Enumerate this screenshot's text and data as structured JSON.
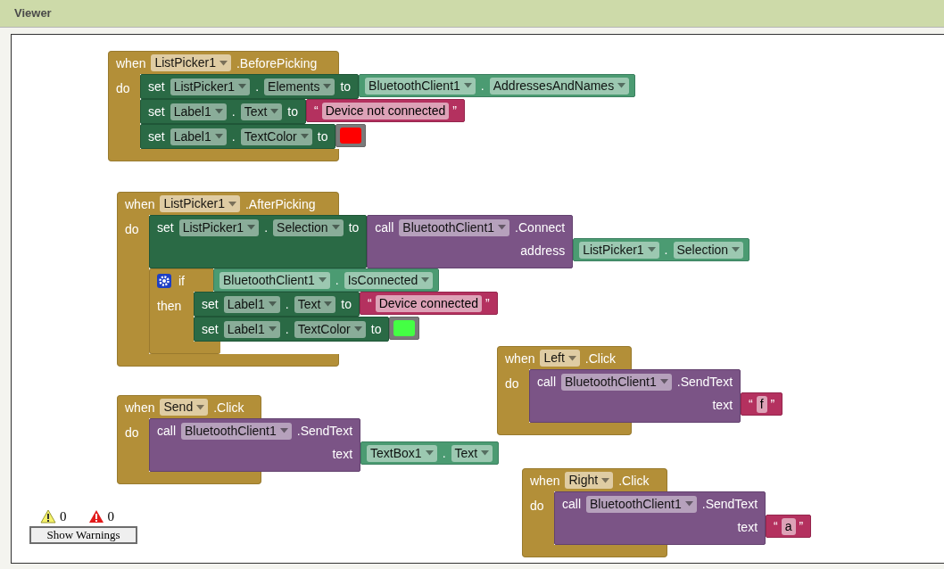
{
  "panel": {
    "title": "Viewer"
  },
  "blocks": [
    {
      "kind": "event",
      "when": "when",
      "component": "ListPicker1",
      "event": ".BeforePicking",
      "do": "do",
      "statements": [
        {
          "kind": "set",
          "keyword": "set",
          "component": "ListPicker1",
          "dot": ".",
          "property": "Elements",
          "to": "to",
          "value": {
            "kind": "getter",
            "component": "BluetoothClient1",
            "dot": ".",
            "property": "AddressesAndNames"
          }
        },
        {
          "kind": "set",
          "keyword": "set",
          "component": "Label1",
          "dot": ".",
          "property": "Text",
          "to": "to",
          "value": {
            "kind": "text",
            "open": "“",
            "text": "Device not connected",
            "close": "”"
          }
        },
        {
          "kind": "set",
          "keyword": "set",
          "component": "Label1",
          "dot": ".",
          "property": "TextColor",
          "to": "to",
          "value": {
            "kind": "color",
            "color": "#ff0000"
          }
        }
      ]
    },
    {
      "kind": "event",
      "when": "when",
      "component": "ListPicker1",
      "event": ".AfterPicking",
      "do": "do",
      "statements": [
        {
          "kind": "set",
          "keyword": "set",
          "component": "ListPicker1",
          "dot": ".",
          "property": "Selection",
          "to": "to",
          "value": {
            "kind": "call",
            "keyword": "call",
            "component": "BluetoothClient1",
            "method": ".Connect",
            "arg_label": "address",
            "arg": {
              "kind": "getter",
              "component": "ListPicker1",
              "dot": ".",
              "property": "Selection"
            }
          }
        },
        {
          "kind": "if",
          "if": "if",
          "then": "then",
          "condition": {
            "kind": "getter",
            "component": "BluetoothClient1",
            "dot": ".",
            "property": "IsConnected"
          },
          "statements": [
            {
              "kind": "set",
              "keyword": "set",
              "component": "Label1",
              "dot": ".",
              "property": "Text",
              "to": "to",
              "value": {
                "kind": "text",
                "open": "“",
                "text": "Device connected",
                "close": "”"
              }
            },
            {
              "kind": "set",
              "keyword": "set",
              "component": "Label1",
              "dot": ".",
              "property": "TextColor",
              "to": "to",
              "value": {
                "kind": "color",
                "color": "#44ff44"
              }
            }
          ]
        }
      ]
    },
    {
      "kind": "event",
      "when": "when",
      "component": "Left",
      "event": ".Click",
      "do": "do",
      "statements": [
        {
          "kind": "call",
          "keyword": "call",
          "component": "BluetoothClient1",
          "method": ".SendText",
          "arg_label": "text",
          "arg": {
            "kind": "text",
            "open": "“",
            "text": "f",
            "close": "”"
          }
        }
      ]
    },
    {
      "kind": "event",
      "when": "when",
      "component": "Send",
      "event": ".Click",
      "do": "do",
      "statements": [
        {
          "kind": "call",
          "keyword": "call",
          "component": "BluetoothClient1",
          "method": ".SendText",
          "arg_label": "text",
          "arg": {
            "kind": "getter",
            "component": "TextBox1",
            "dot": ".",
            "property": "Text"
          }
        }
      ]
    },
    {
      "kind": "event",
      "when": "when",
      "component": "Right",
      "event": ".Click",
      "do": "do",
      "statements": [
        {
          "kind": "call",
          "keyword": "call",
          "component": "BluetoothClient1",
          "method": ".SendText",
          "arg_label": "text",
          "arg": {
            "kind": "text",
            "open": "“",
            "text": "a",
            "close": "”"
          }
        }
      ]
    }
  ],
  "warnings": {
    "warning_count": "0",
    "error_count": "0",
    "button": "Show Warnings"
  }
}
